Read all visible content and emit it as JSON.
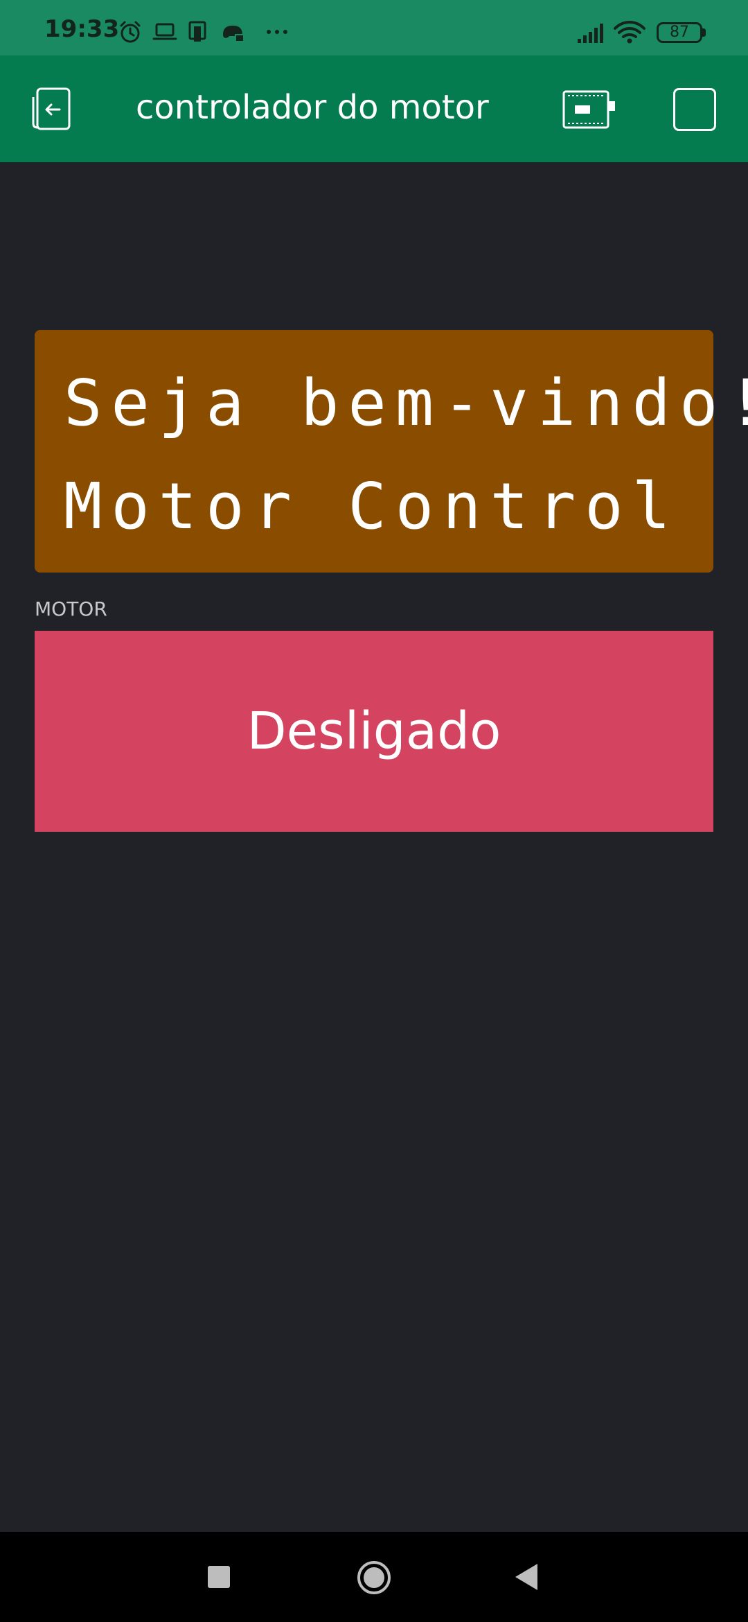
{
  "status_bar": {
    "time": "19:33",
    "battery": "87",
    "icons": [
      "alarm-icon",
      "laptop-icon",
      "device-icon",
      "game-icon",
      "more-dots-icon",
      "signal-icon",
      "wifi-icon",
      "battery-icon"
    ]
  },
  "app_bar": {
    "title": "controlador do motor",
    "icons": [
      "exit-icon",
      "device-board-icon",
      "square-icon"
    ]
  },
  "lcd": {
    "line1": "Seja bem-vindo!",
    "line2": "Motor Control",
    "background": "#8a4d00"
  },
  "motor": {
    "label": "MOTOR",
    "button_text": "Desligado",
    "button_color": "#d44460"
  },
  "nav_bar": {
    "icons": [
      "recent-apps-icon",
      "home-icon",
      "back-icon"
    ]
  }
}
